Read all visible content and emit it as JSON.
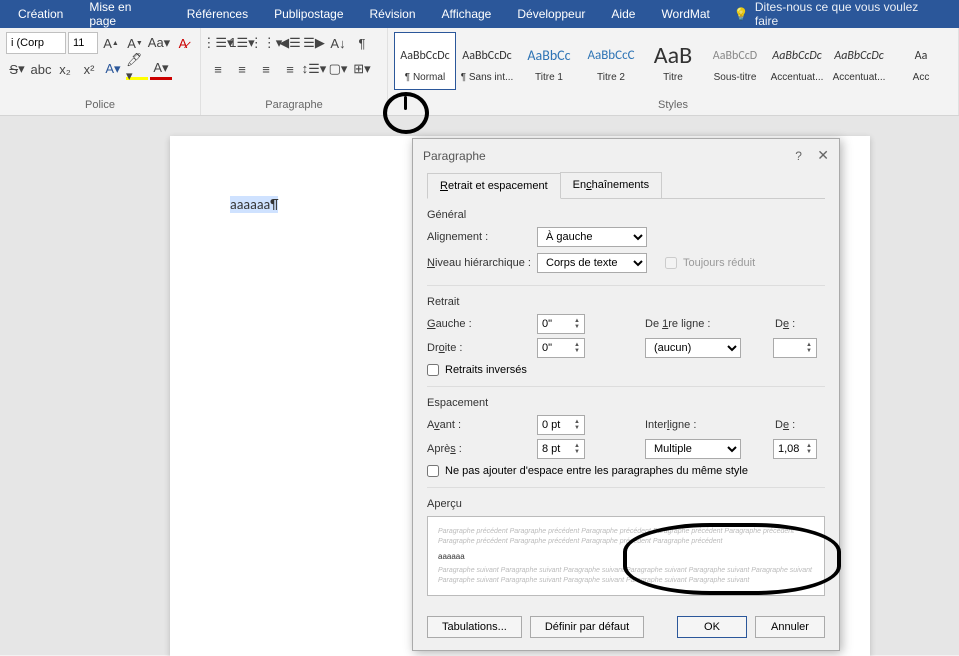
{
  "menu": {
    "items": [
      "Création",
      "Mise en page",
      "Références",
      "Publipostage",
      "Révision",
      "Affichage",
      "Développeur",
      "Aide",
      "WordMat"
    ],
    "tell_me": "Dites-nous ce que vous voulez faire"
  },
  "ribbon": {
    "font": {
      "name_value": "i (Corp",
      "size_value": "11",
      "group_label": "Police"
    },
    "paragraph": {
      "group_label": "Paragraphe"
    },
    "styles": {
      "group_label": "Styles",
      "items": [
        {
          "preview": "AaBbCcDc",
          "name": "¶ Normal",
          "cls": "s-normal",
          "selected": true
        },
        {
          "preview": "AaBbCcDc",
          "name": "¶ Sans int...",
          "cls": "s-normal"
        },
        {
          "preview": "AaBbCc",
          "name": "Titre 1",
          "cls": "s-t1"
        },
        {
          "preview": "AaBbCcC",
          "name": "Titre 2",
          "cls": "s-t2"
        },
        {
          "preview": "AaB",
          "name": "Titre",
          "cls": "s-titre"
        },
        {
          "preview": "AaBbCcD",
          "name": "Sous-titre",
          "cls": "s-sous"
        },
        {
          "preview": "AaBbCcDc",
          "name": "Accentuat...",
          "cls": "s-acc-i"
        },
        {
          "preview": "AaBbCcDc",
          "name": "Accentuat...",
          "cls": "s-acc"
        },
        {
          "preview": "Aa",
          "name": "Acc",
          "cls": "s-acc2"
        }
      ]
    }
  },
  "document": {
    "text": "aaaaaa¶"
  },
  "dialog": {
    "title": "Paragraphe",
    "tabs": [
      "Retrait et espacement",
      "Enchaînements"
    ],
    "general": {
      "title": "Général",
      "alignment_label": "Alignement :",
      "alignment_value": "À gauche",
      "outline_label": "Niveau hiérarchique :",
      "outline_value": "Corps de texte",
      "collapsed_label": "Toujours réduit"
    },
    "retrait": {
      "title": "Retrait",
      "gauche_label": "Gauche :",
      "gauche_value": "0\"",
      "droite_label": "Droite :",
      "droite_value": "0\"",
      "first_line_label": "De 1re ligne :",
      "first_line_value": "(aucun)",
      "de_label": "De :",
      "de_value": "",
      "mirror_label": "Retraits inversés"
    },
    "espacement": {
      "title": "Espacement",
      "avant_label": "Avant :",
      "avant_value": "0 pt",
      "apres_label": "Après :",
      "apres_value": "8 pt",
      "interligne_label": "Interligne :",
      "interligne_value": "Multiple",
      "de2_label": "De :",
      "de2_value": "1,08",
      "no_space_label": "Ne pas ajouter d'espace entre les paragraphes du même style"
    },
    "apercu": {
      "title": "Aperçu",
      "before": "Paragraphe précédent Paragraphe précédent Paragraphe précédent Paragraphe précédent Paragraphe précédent Paragraphe précédent Paragraphe précédent Paragraphe précédent Paragraphe précédent",
      "sample": "aaaaaa",
      "after": "Paragraphe suivant Paragraphe suivant Paragraphe suivant Paragraphe suivant Paragraphe suivant Paragraphe suivant Paragraphe suivant Paragraphe suivant Paragraphe suivant Paragraphe suivant Paragraphe suivant"
    },
    "buttons": {
      "tabulations": "Tabulations...",
      "default": "Définir par défaut",
      "ok": "OK",
      "cancel": "Annuler"
    }
  }
}
